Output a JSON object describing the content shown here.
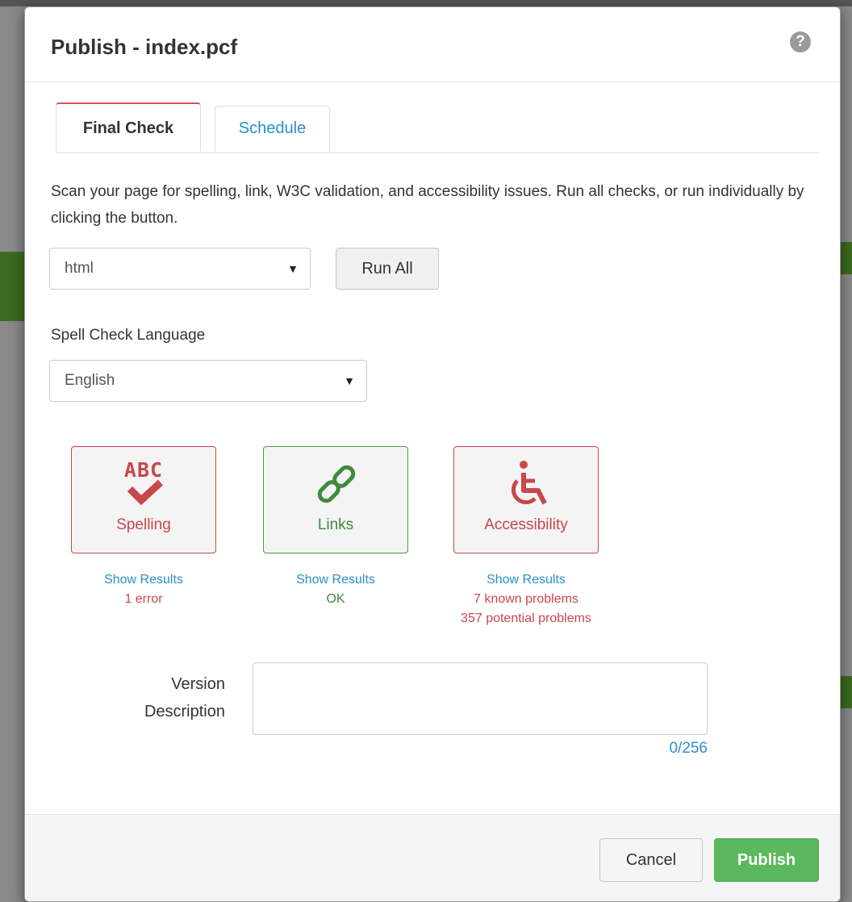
{
  "dialog": {
    "title": "Publish - index.pcf",
    "help_icon": "question-circle-icon"
  },
  "tabs": [
    {
      "label": "Final Check",
      "active": true
    },
    {
      "label": "Schedule",
      "active": false
    }
  ],
  "intro_text": "Scan your page for spelling, link, W3C validation, and accessibility issues. Run all checks, or run individually by clicking the button.",
  "check_type_select": {
    "value": "html"
  },
  "run_all_label": "Run All",
  "spell_language": {
    "label": "Spell Check Language",
    "value": "English"
  },
  "checks": {
    "spelling": {
      "icon_text": "ABC",
      "icon": "abc-check-icon",
      "label": "Spelling",
      "show_results": "Show Results",
      "status": [
        "1 error"
      ],
      "color": "#c9474a"
    },
    "links": {
      "icon": "link-icon",
      "label": "Links",
      "show_results": "Show Results",
      "status": [
        "OK"
      ],
      "color": "#3d8b3d"
    },
    "accessibility": {
      "icon": "wheelchair-icon",
      "label": "Accessibility",
      "show_results": "Show Results",
      "status": [
        "7 known problems",
        "357 potential problems"
      ],
      "color": "#c9474a"
    }
  },
  "version_description": {
    "label_line1": "Version",
    "label_line2": "Description",
    "value": "",
    "counter": "0/256"
  },
  "footer": {
    "cancel_label": "Cancel",
    "publish_label": "Publish"
  },
  "colors": {
    "primary": "#5cb85c",
    "link": "#2a8fcb",
    "error": "#c9474a",
    "ok": "#3d8b3d"
  }
}
